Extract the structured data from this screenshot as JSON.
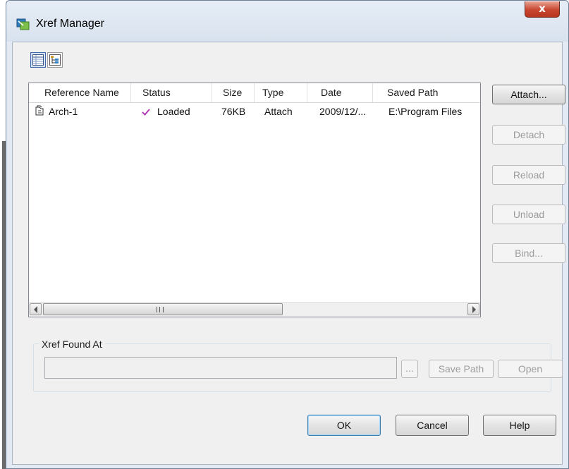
{
  "window": {
    "title": "Xref Manager",
    "close_label": "x",
    "icon": "xref-manager-app-icon"
  },
  "toolbar": {
    "list_view_icon": "list-view-icon",
    "tree_view_icon": "tree-view-icon"
  },
  "list": {
    "columns": [
      "Reference Name",
      "Status",
      "Size",
      "Type",
      "Date",
      "Saved Path"
    ],
    "rows": [
      {
        "icon": "xref-file-icon",
        "name": "Arch-1",
        "status_icon": "check-icon",
        "status": "Loaded",
        "size": "76KB",
        "type": "Attach",
        "date": "2009/12/...",
        "saved_path": "E:\\Program Files"
      }
    ],
    "scrollbar_grip": "III"
  },
  "actions": {
    "attach": "Attach...",
    "detach": "Detach",
    "reload": "Reload",
    "unload": "Unload",
    "bind": "Bind..."
  },
  "found_at": {
    "label": "Xref Found At",
    "value": "",
    "browse": "...",
    "save_path": "Save Path",
    "open": "Open"
  },
  "footer": {
    "ok": "OK",
    "cancel": "Cancel",
    "help": "Help"
  },
  "colors": {
    "check": "#b03bb5",
    "close_button": "#c8452f",
    "dialog_frame": "#e3eaf3"
  }
}
